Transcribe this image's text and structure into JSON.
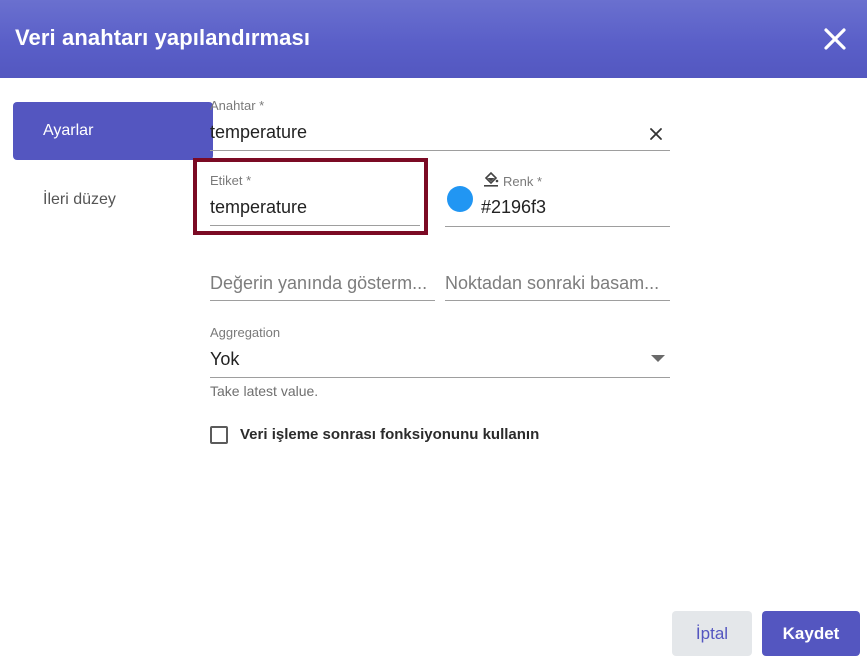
{
  "dialog": {
    "title": "Veri anahtarı yapılandırması",
    "close_icon": "close-icon"
  },
  "nav": {
    "items": [
      {
        "label": "Ayarlar",
        "active": true
      },
      {
        "label": "İleri düzey",
        "active": false
      }
    ]
  },
  "form": {
    "key": {
      "label": "Anahtar *",
      "value": "temperature",
      "clear_icon": "clear-icon"
    },
    "label_field": {
      "label": "Etiket *",
      "value": "temperature"
    },
    "color": {
      "label": "Renk *",
      "value": "#2196f3",
      "display_value": "#2196f3",
      "icon": "paint-bucket-icon"
    },
    "units": {
      "placeholder": "Değerin yanında gösterm..."
    },
    "decimals": {
      "placeholder": "Noktadan sonraki basam..."
    },
    "aggregation": {
      "label": "Aggregation",
      "value": "Yok",
      "hint": "Take latest value."
    },
    "post_processing": {
      "label": "Veri işleme sonrası fonksiyonunu kullanın",
      "checked": false
    }
  },
  "actions": {
    "cancel_label": "İptal",
    "save_label": "Kaydet"
  },
  "colors": {
    "header": "#5a5fc8",
    "accent": "#5456c0",
    "highlight": "#7b0a24",
    "swatch": "#2196f3"
  }
}
